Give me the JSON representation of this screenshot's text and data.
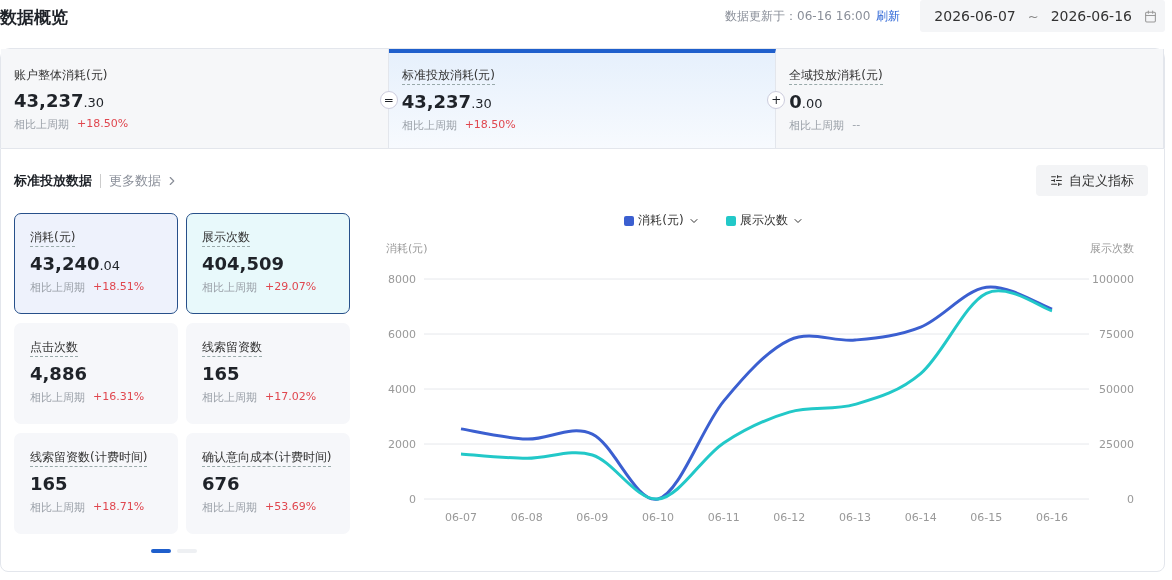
{
  "header": {
    "title": "数据概览",
    "update_label": "数据更新于：06-16 16:00",
    "refresh": "刷新",
    "date_range": {
      "start": "2026-06-07",
      "separator": "~",
      "end": "2026-06-16"
    }
  },
  "summary_cards": [
    {
      "label": "账户整体消耗(元)",
      "value_int": "43,237",
      "value_dec": ".30",
      "compare_label": "相比上周期",
      "change": "+18.50%",
      "kind": "up",
      "selected": false
    },
    {
      "label": "标准投放消耗(元)",
      "value_int": "43,237",
      "value_dec": ".30",
      "compare_label": "相比上周期",
      "change": "+18.50%",
      "kind": "up",
      "selected": true,
      "operator": "="
    },
    {
      "label": "全域投放消耗(元)",
      "value_int": "0",
      "value_dec": ".00",
      "compare_label": "相比上周期",
      "change": "--",
      "kind": "flat",
      "selected": false,
      "operator": "+"
    }
  ],
  "section": {
    "title": "标准投放数据",
    "more_link": "更多数据",
    "custom_button": "自定义指标"
  },
  "metrics": [
    {
      "label": "消耗(元)",
      "value_int": "43,240",
      "value_dec": ".04",
      "compare_label": "相比上周期",
      "change": "+18.51%",
      "selected": true
    },
    {
      "label": "展示次数",
      "value_int": "404,509",
      "compare_label": "相比上周期",
      "change": "+29.07%",
      "selected": true
    },
    {
      "label": "点击次数",
      "value_int": "4,886",
      "compare_label": "相比上周期",
      "change": "+16.31%",
      "selected": false
    },
    {
      "label": "线索留资数",
      "value_int": "165",
      "compare_label": "相比上周期",
      "change": "+17.02%",
      "selected": false
    },
    {
      "label": "线索留资数(计费时间)",
      "value_int": "165",
      "compare_label": "相比上周期",
      "change": "+18.71%",
      "selected": false
    },
    {
      "label": "确认意向成本(计费时间)",
      "value_int": "676",
      "compare_label": "相比上周期",
      "change": "+53.69%",
      "selected": false
    }
  ],
  "pagination": [
    {
      "selected": true
    },
    {
      "selected": false
    }
  ],
  "chart_data": {
    "type": "line",
    "ylabel": "消耗(元)",
    "y2label": "展示次数",
    "categories": [
      "06-07",
      "06-08",
      "06-09",
      "06-10",
      "06-11",
      "06-12",
      "06-13",
      "06-14",
      "06-15",
      "06-16"
    ],
    "grid": true,
    "legend": "top",
    "ylim": [
      0,
      8000
    ],
    "yticks": [
      0,
      2000,
      4000,
      6000,
      8000
    ],
    "y2lim": [
      0,
      100000
    ],
    "y2ticks": [
      0,
      25000,
      50000,
      75000,
      100000
    ],
    "series": [
      {
        "name": "消耗(元)",
        "color": "#3b5fd0",
        "values": [
          2550,
          2180,
          2360,
          0,
          3560,
          5780,
          5780,
          6250,
          7700,
          6900
        ]
      },
      {
        "name": "展示次数",
        "color": "#22c8c8",
        "axis": "y2",
        "values": [
          20500,
          18500,
          20000,
          0,
          25500,
          39500,
          43000,
          57000,
          93500,
          85500
        ]
      }
    ]
  }
}
